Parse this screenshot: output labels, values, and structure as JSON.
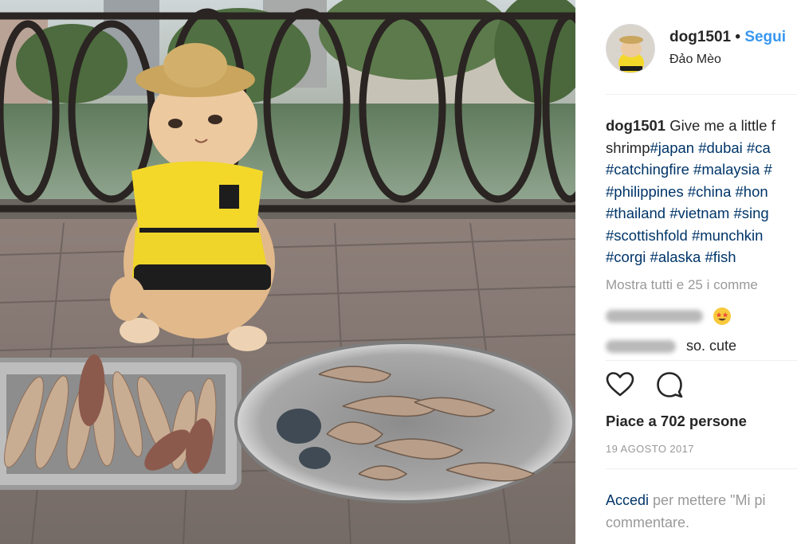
{
  "post": {
    "username": "dog1501",
    "separator": "•",
    "follow_label": "Segui",
    "location": "Đảo Mèo",
    "caption": {
      "line1_text": "Give me a little f",
      "line2_text": "shrimp",
      "line2_tags": [
        "#japan",
        "#dubai",
        "#ca"
      ],
      "line3_tags": [
        "#catchingfire",
        "#malaysia",
        "#"
      ],
      "line4_tags": [
        "#philippines",
        "#china",
        "#hon"
      ],
      "line5_tags": [
        "#thailand",
        "#vietnam",
        "#sing"
      ],
      "line6_tags": [
        "#scottishfold",
        "#munchkin"
      ],
      "line7_tags": [
        "#corgi",
        "#alaska",
        "#fish"
      ]
    },
    "show_all_comments": "Mostra tutti e 25 i comme",
    "comments": [
      {
        "text": ""
      },
      {
        "text": "so. cute"
      }
    ],
    "likes": "Piace a 702 persone",
    "date": "19 AGOSTO 2017",
    "login": {
      "link": "Accedi",
      "text1": "per mettere \"Mi pi",
      "text2": "commentare."
    }
  },
  "icons": {
    "like": "heart-icon",
    "comment": "comment-icon",
    "emoji": "star-struck-emoji"
  },
  "colors": {
    "link_blue": "#3897f0",
    "hashtag": "#003569",
    "muted": "#999999",
    "text": "#262626"
  }
}
